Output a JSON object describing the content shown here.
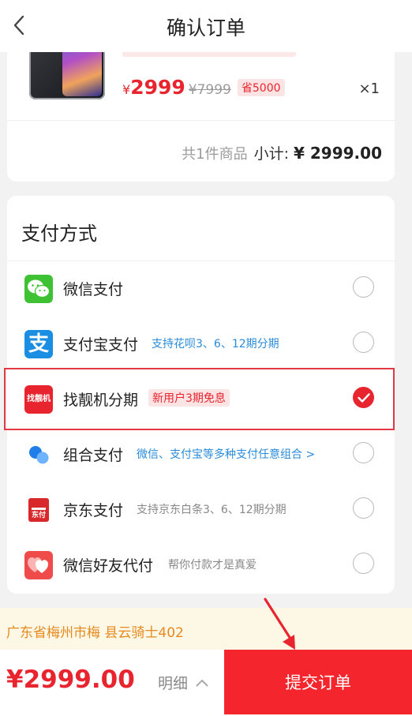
{
  "header": {
    "title": "确认订单"
  },
  "product": {
    "price_symbol": "¥",
    "price": "2999",
    "original_price": "¥7999",
    "save_badge": "省5000",
    "quantity": "×1",
    "total_count": "共1件商品",
    "subtotal_label": "小计:",
    "subtotal_value": "¥ 2999.00"
  },
  "payment": {
    "title": "支付方式",
    "methods": [
      {
        "name": "微信支付",
        "tag": "",
        "icon": "wechat-pay-icon",
        "selected": false
      },
      {
        "name": "支付宝支付",
        "tag": "支持花呗3、6、12期分期",
        "tag_color": "#2a8bd8",
        "icon": "alipay-icon",
        "selected": false
      },
      {
        "name": "找靓机分期",
        "tag": "新用户3期免息",
        "tag_color": "#e8242f",
        "icon": "zhaoliangji-icon",
        "icon_text": "找靓机",
        "selected": true
      },
      {
        "name": "组合支付",
        "tag": "微信、支付宝等多种支付任意组合 >",
        "tag_color": "#2a8bd8",
        "icon": "combined-pay-icon",
        "selected": false
      },
      {
        "name": "京东支付",
        "tag": "支持京东白条3、6、12期分期",
        "tag_color": "#888888",
        "icon": "jd-pay-icon",
        "icon_text": "东付",
        "selected": false
      },
      {
        "name": "微信好友代付",
        "tag": "帮你付款才是真爱",
        "tag_color": "#888888",
        "icon": "friend-pay-icon",
        "selected": false
      }
    ]
  },
  "address": {
    "text": "广东省梅州市梅   县云骑士402"
  },
  "footer": {
    "total_price": "¥2999.00",
    "detail_label": "明细",
    "submit_label": "提交订单"
  },
  "colors": {
    "accent": "#f4252d",
    "price": "#e8242f",
    "highlight_border": "#e23a44"
  }
}
